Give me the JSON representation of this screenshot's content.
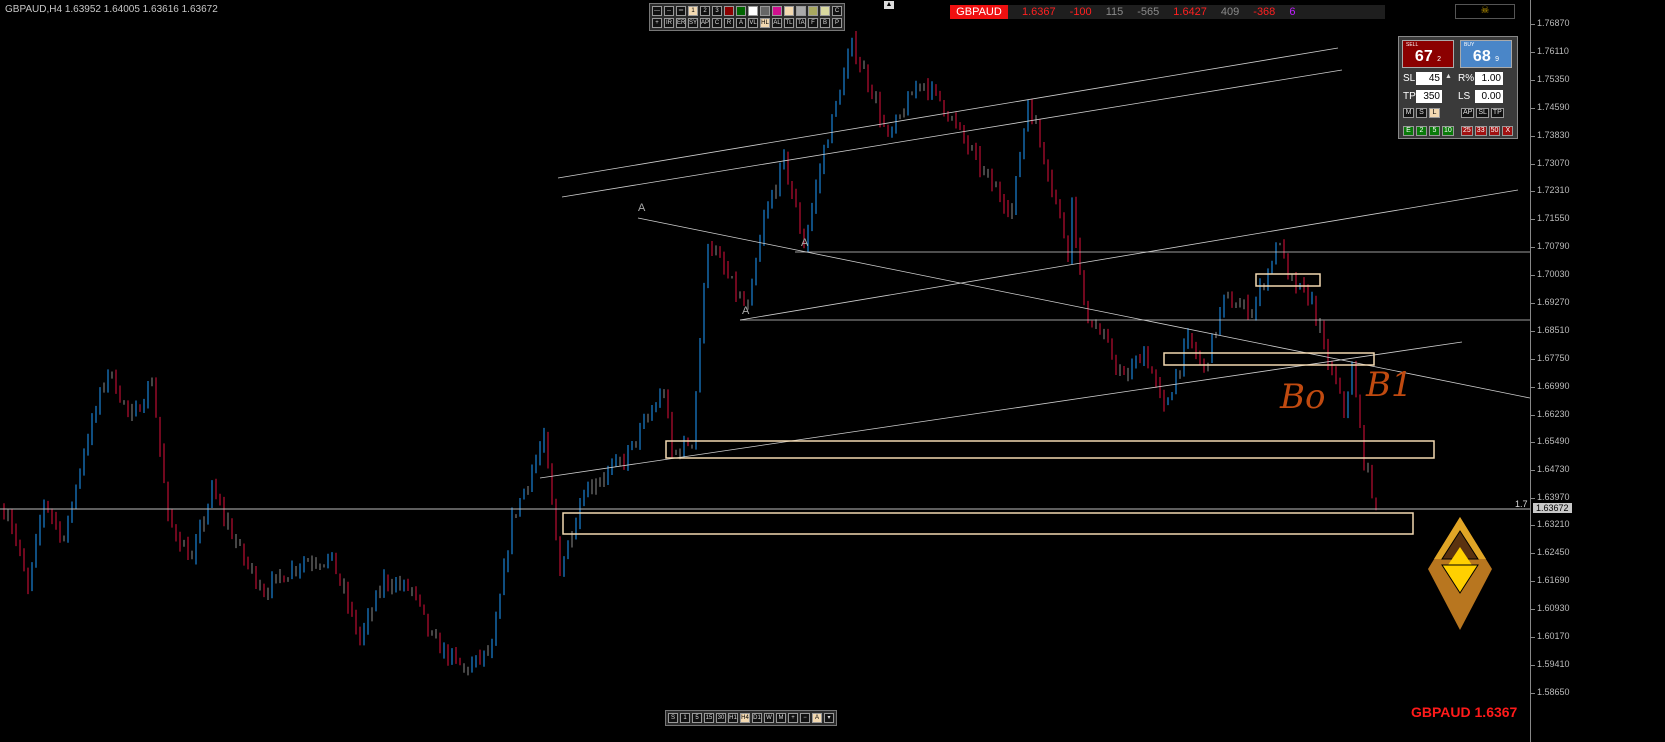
{
  "header": {
    "symbol_info": "GBPAUD,H4  1.63952 1.64005 1.63616 1.63672"
  },
  "ticker": {
    "symbol": "GBPAUD",
    "values": [
      {
        "v": "1.6367",
        "c": "#ff2020"
      },
      {
        "v": "-100",
        "c": "#ff2020"
      },
      {
        "v": "115",
        "c": "#8a8a8a"
      },
      {
        "v": "-565",
        "c": "#8a8a8a"
      },
      {
        "v": "1.6427",
        "c": "#ff2020"
      },
      {
        "v": "409",
        "c": "#8a8a8a"
      },
      {
        "v": "-368",
        "c": "#ff2020"
      },
      {
        "v": "6",
        "c": "#c020ff"
      }
    ]
  },
  "toolbar_top": {
    "row1": [
      "---",
      "--",
      "═",
      "1",
      "2",
      "3"
    ],
    "colors": [
      "#8b0000",
      "#006400",
      "#ffffff",
      "#666666",
      "#d0108f",
      "#f3d9b1",
      "#aaaaaa",
      "#a8a860",
      "#d8d8a0"
    ],
    "row1_end": "C",
    "row2": [
      "+",
      "IR",
      "ER",
      "SY",
      "AP",
      "C",
      "R",
      "A",
      "VL",
      "HL",
      "AL",
      "TL",
      "TA",
      "F",
      "B",
      "P"
    ],
    "active": [
      "1",
      "HL"
    ]
  },
  "toolbar_bottom": {
    "buttons": [
      "S",
      "1",
      "5",
      "15",
      "30",
      "H1",
      "H4",
      "D1",
      "W",
      "M",
      "+",
      "−",
      "A",
      "▾"
    ],
    "active": [
      "H4",
      "A"
    ]
  },
  "trade_panel": {
    "sell_label": "SELL",
    "sell_price": "67",
    "sell_frac": "2",
    "buy_label": "BUY",
    "buy_price": "68",
    "buy_frac": "9",
    "sl_label": "SL",
    "sl_value": "45",
    "tp_label": "TP",
    "tp_value": "350",
    "risk_label": "R%",
    "risk_value": "1.00",
    "ls_label": "LS",
    "ls_value": "0.00",
    "mode_buttons": [
      "M",
      "S",
      "L"
    ],
    "action_buttons": [
      "AP",
      "SL",
      "TP"
    ],
    "green_buttons": [
      "E",
      "2",
      "5",
      "10"
    ],
    "red_buttons": [
      "25",
      "33",
      "50",
      "X"
    ]
  },
  "skull_icon": "skull-icon",
  "bottom_label": "GBPAUD 1.6367",
  "annotations": {
    "A1": "A",
    "A2": "A",
    "A3": "A",
    "hand1": "Bo",
    "hand2": "B1",
    "spread_label": "1.7"
  },
  "chart_data": {
    "type": "candlestick",
    "symbol": "GBPAUD",
    "timeframe": "H4",
    "last": {
      "open": 1.63952,
      "high": 1.64005,
      "low": 1.63616,
      "close": 1.63672
    },
    "ylim": [
      1.5865,
      1.7687
    ],
    "y_ticks": [
      "1.76870",
      "1.76110",
      "1.75350",
      "1.74590",
      "1.73830",
      "1.73070",
      "1.72310",
      "1.71550",
      "1.70790",
      "1.70030",
      "1.69270",
      "1.68510",
      "1.67750",
      "1.66990",
      "1.66230",
      "1.65490",
      "1.64730",
      "1.63970",
      "1.63210",
      "1.62450",
      "1.61690",
      "1.60930",
      "1.60170",
      "1.59410",
      "1.58650"
    ],
    "current_price": "1.63672",
    "up_color": "#1e9bff",
    "down_color": "#e0103c",
    "neutral_color": "#8c8c8c",
    "approx_path": {
      "bar": [
        1,
        6,
        10,
        15,
        20,
        26,
        32,
        37,
        41,
        47,
        52,
        60,
        65,
        75,
        82,
        89,
        95,
        102,
        107,
        115,
        122,
        127,
        135,
        139,
        145,
        155,
        165,
        167,
        172,
        176,
        184,
        186,
        190,
        195,
        200,
        205,
        212,
        217,
        221,
        229,
        234,
        240,
        246,
        252,
        256,
        261,
        266,
        267,
        270,
        275,
        280,
        285,
        290,
        296,
        300,
        305,
        312,
        319,
        321,
        327,
        330,
        335,
        337,
        340,
        343
      ],
      "close": [
        1.6363,
        1.6145,
        1.639,
        1.6281,
        1.6527,
        1.6745,
        1.6608,
        1.6717,
        1.6336,
        1.6227,
        1.6418,
        1.6227,
        1.6145,
        1.6227,
        1.6227,
        1.6009,
        1.6173,
        1.6145,
        1.6009,
        1.5927,
        1.5982,
        1.6336,
        1.6554,
        1.62,
        1.6418,
        1.6499,
        1.669,
        1.6513,
        1.6554,
        1.7099,
        1.6935,
        1.6908,
        1.7153,
        1.7317,
        1.7085,
        1.7344,
        1.763,
        1.7507,
        1.7371,
        1.7535,
        1.748,
        1.7371,
        1.7262,
        1.718,
        1.748,
        1.7289,
        1.7071,
        1.7208,
        1.6908,
        1.6826,
        1.6717,
        1.6799,
        1.6636,
        1.6826,
        1.6745,
        1.6935,
        1.6908,
        1.7099,
        1.699,
        1.6935,
        1.6799,
        1.6636,
        1.6745,
        1.6499,
        1.6377
      ]
    },
    "grid": false
  }
}
